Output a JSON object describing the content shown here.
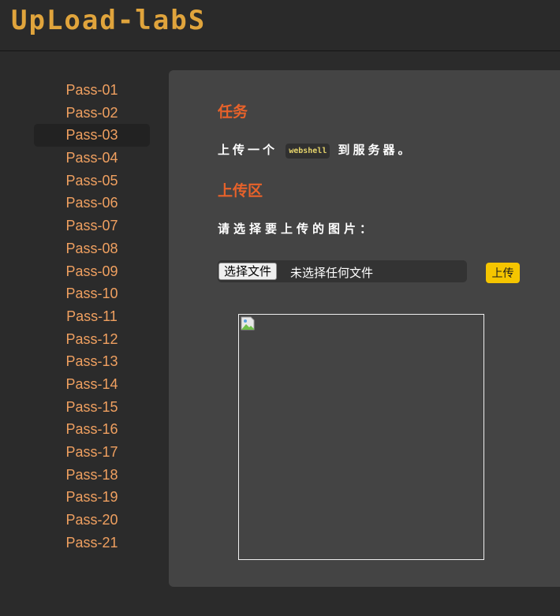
{
  "header": {
    "logo_text": "UpLoad-labS"
  },
  "sidebar": {
    "items": [
      {
        "label": "Pass-01"
      },
      {
        "label": "Pass-02"
      },
      {
        "label": "Pass-03"
      },
      {
        "label": "Pass-04"
      },
      {
        "label": "Pass-05"
      },
      {
        "label": "Pass-06"
      },
      {
        "label": "Pass-07"
      },
      {
        "label": "Pass-08"
      },
      {
        "label": "Pass-09"
      },
      {
        "label": "Pass-10"
      },
      {
        "label": "Pass-11"
      },
      {
        "label": "Pass-12"
      },
      {
        "label": "Pass-13"
      },
      {
        "label": "Pass-14"
      },
      {
        "label": "Pass-15"
      },
      {
        "label": "Pass-16"
      },
      {
        "label": "Pass-17"
      },
      {
        "label": "Pass-18"
      },
      {
        "label": "Pass-19"
      },
      {
        "label": "Pass-20"
      },
      {
        "label": "Pass-21"
      }
    ],
    "active_index": 2
  },
  "main": {
    "task_title": "任务",
    "task_before": "上传一个",
    "task_code": "webshell",
    "task_after": "到服务器。",
    "upload_area_title": "上传区",
    "prompt": "请选择要上传的图片：",
    "file_button_label": "选择文件",
    "file_status": "未选择任何文件",
    "upload_button_label": "上传"
  },
  "colors": {
    "accent_orange": "#e8622a",
    "nav_link": "#f0a060",
    "logo": "#e0a43c",
    "upload_button": "#f5c500",
    "code_text": "#e5d36a"
  },
  "icons": {
    "preview": "broken-image-icon"
  }
}
